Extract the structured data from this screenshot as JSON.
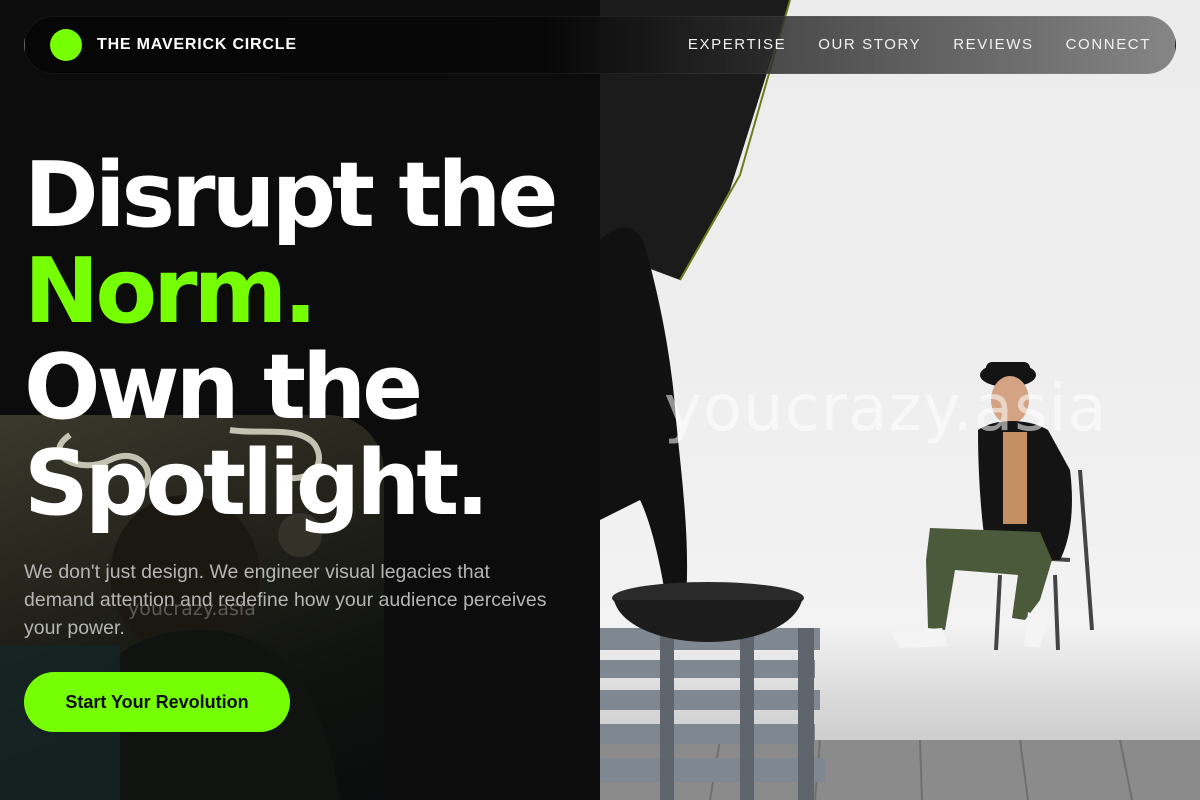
{
  "nav": {
    "brand": "THE MAVERICK CIRCLE",
    "links": [
      "EXPERTISE",
      "OUR STORY",
      "REVIEWS",
      "CONNECT"
    ]
  },
  "hero": {
    "line1": "Disrupt the",
    "line2": "Norm.",
    "line3": "Own the",
    "line4": "Spotlight.",
    "subtext": "We don't just design. We engineer visual legacies that demand attention and redefine how your audience perceives your power.",
    "cta_label": "Start Your Revolution"
  },
  "watermarks": {
    "photo": "youcrazy.asia",
    "inset": "youcrazy.asia"
  },
  "colors": {
    "accent": "#76ff03",
    "background": "#0c0c0c",
    "subtext": "#b5b5b5"
  },
  "icons": {
    "logo": "green-dot-logo"
  }
}
